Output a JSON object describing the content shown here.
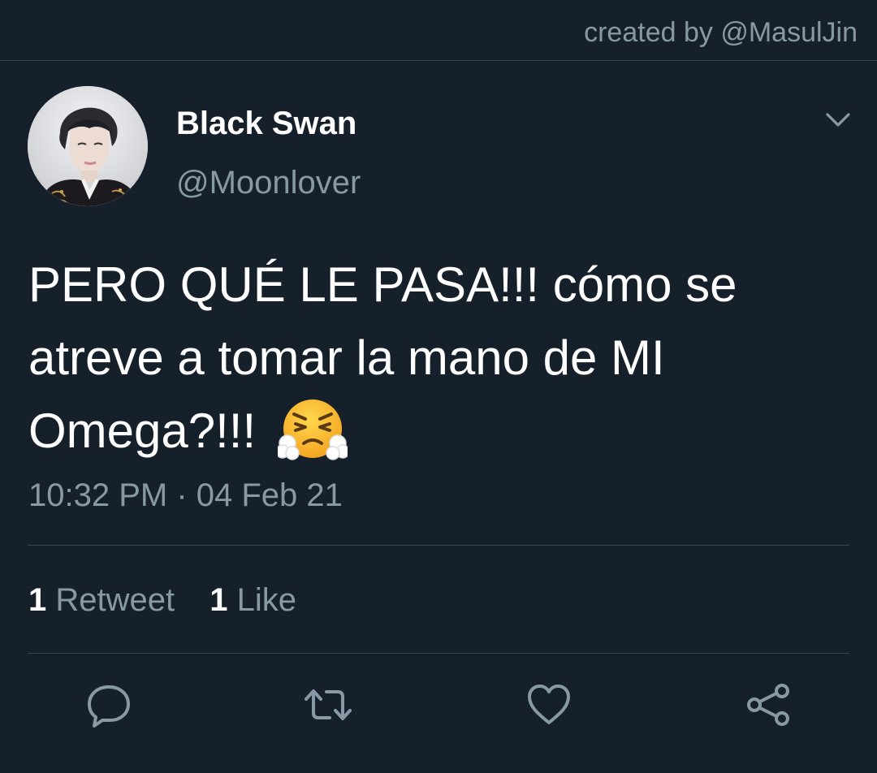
{
  "header": {
    "credit": "created by @MasulJin"
  },
  "tweet": {
    "display_name": "Black Swan",
    "handle": "@Moonlover",
    "text": "PERO QUÉ LE PASA!!! cómo se atreve a tomar la mano de MI Omega?!!!",
    "emoji": "face-with-steam-from-nose",
    "timestamp": "10:32 PM · 04 Feb 21",
    "retweets_count": "1",
    "retweets_label": "Retweet",
    "likes_count": "1",
    "likes_label": "Like"
  },
  "actions": {
    "reply_icon": "reply-icon",
    "retweet_icon": "retweet-icon",
    "like_icon": "heart-icon",
    "share_icon": "share-icon"
  },
  "colors": {
    "background": "#15202b",
    "divider": "#38444d",
    "secondary_text": "#8899a6",
    "primary_text": "#ffffff"
  }
}
